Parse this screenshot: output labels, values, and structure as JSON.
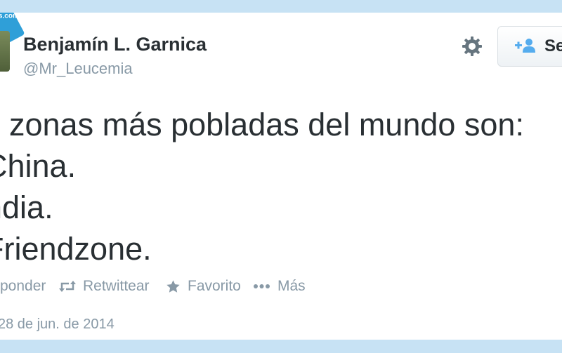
{
  "watermark": {
    "text": "Ues.com"
  },
  "author": {
    "name": "Benjamín L. Garnica",
    "handle": "@Mr_Leucemia"
  },
  "follow": {
    "label": "Se"
  },
  "tweet": {
    "lines": [
      "s zonas más pobladas del mundo son:",
      "China.",
      "ndia.",
      "Friendzone."
    ]
  },
  "actions": {
    "reply": "ponder",
    "retweet": "Retwittear",
    "favorite": "Favorito",
    "more": "Más"
  },
  "date": "28 de jun. de 2014",
  "colors": {
    "background": "#c7e2f4",
    "text": "#292f33",
    "muted": "#8899a6",
    "accent": "#2f9fd8"
  }
}
